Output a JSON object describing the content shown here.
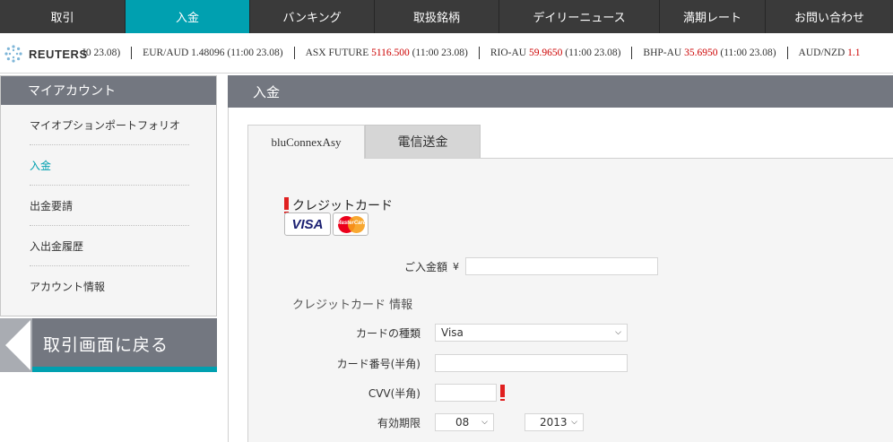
{
  "nav": {
    "items": [
      {
        "label": "取引"
      },
      {
        "label": "入金"
      },
      {
        "label": "バンキング"
      },
      {
        "label": "取扱銘柄"
      },
      {
        "label": "デイリーニュース"
      },
      {
        "label": "満期レート"
      },
      {
        "label": "お問い合わせ"
      }
    ],
    "active_index": 1
  },
  "ticker": {
    "logo_text": "REUTERS",
    "items": [
      {
        "name": "",
        "value": "",
        "time": "I0 23.08)"
      },
      {
        "name": "EUR/AUD",
        "value": "1.48096",
        "time": "(11:00 23.08)",
        "plain": true
      },
      {
        "name": "ASX FUTURE",
        "value": "5116.500",
        "time": "(11:00 23.08)"
      },
      {
        "name": "RIO-AU",
        "value": "59.9650",
        "time": "(11:00 23.08)"
      },
      {
        "name": "BHP-AU",
        "value": "35.6950",
        "time": "(11:00 23.08)"
      },
      {
        "name": "AUD/NZD",
        "value": "1.1",
        "time": ""
      }
    ]
  },
  "sidebar": {
    "title": "マイアカウント",
    "items": [
      {
        "label": "マイオプションポートフォリオ"
      },
      {
        "label": "入金"
      },
      {
        "label": "出金要請"
      },
      {
        "label": "入出金履歴"
      },
      {
        "label": "アカウント情報"
      }
    ],
    "active_index": 1,
    "back_label": "取引画面に戻る"
  },
  "main": {
    "title": "入金",
    "tabs": [
      {
        "label": "bluConnexAsy"
      },
      {
        "label": "電信送金"
      }
    ],
    "credit_card_title": "クレジットカード",
    "cards": {
      "visa": "VISA",
      "mastercard": "MasterCard"
    },
    "amount_label": "ご入金額",
    "currency_symbol": "¥",
    "amount_value": "",
    "card_info_label": "クレジットカード 情報",
    "card_type_label": "カードの種類",
    "card_type_value": "Visa",
    "card_number_label": "カード番号(半角)",
    "card_number_value": "",
    "cvv_label": "CVV(半角)",
    "cvv_value": "",
    "expiry_label": "有効期限",
    "expiry_month": "08",
    "expiry_year": "2013"
  },
  "colors": {
    "accent": "#00a0b0",
    "nav_bg": "#3a3a3a",
    "header_bg": "#737780",
    "required": "#e02020"
  }
}
